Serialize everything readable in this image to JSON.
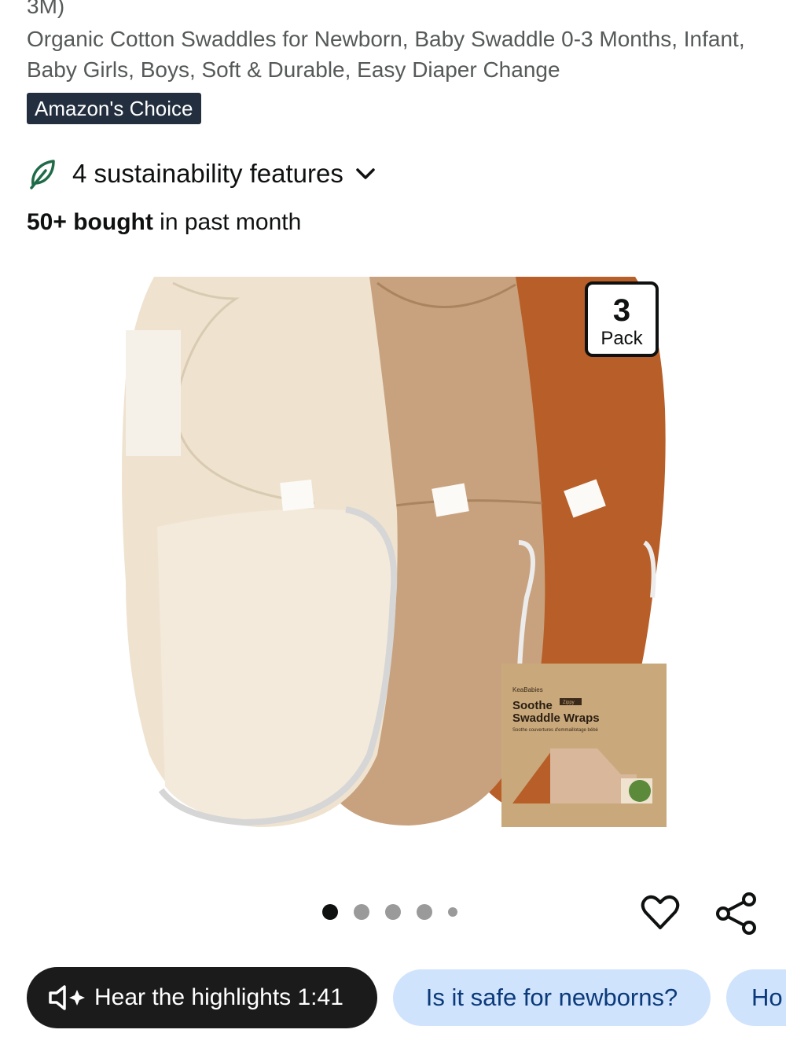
{
  "product": {
    "title_tail": "3M)",
    "title": "Organic Cotton Swaddles for Newborn, Baby Swaddle 0-3 Months, Infant, Baby Girls, Boys, Soft & Durable, Easy Diaper Change",
    "badge": "Amazon's Choice",
    "sustainability": "4 sustainability features",
    "bought_bold": "50+ bought",
    "bought_rest": " in past month"
  },
  "image": {
    "pack_number": "3",
    "pack_label": "Pack",
    "tag_text": "KeaBabies",
    "box_brand": "KeaBabies",
    "box_line1": "Soothe",
    "box_tag": "Zippy",
    "box_line2": "Swaddle Wraps",
    "box_sub": "Soothe couvertures d'emmaillotage bébé",
    "colors": {
      "cream": "#efe3d0",
      "tan": "#c8a27e",
      "rust": "#b85e28",
      "box": "#c9a97c"
    }
  },
  "carousel": {
    "count": 5,
    "active": 0
  },
  "actions": {
    "heart_icon": "heart-icon",
    "share_icon": "share-icon"
  },
  "chips": {
    "hear": "Hear the highlights 1:41",
    "q1": "Is it safe for newborns?",
    "q2": "Ho"
  }
}
